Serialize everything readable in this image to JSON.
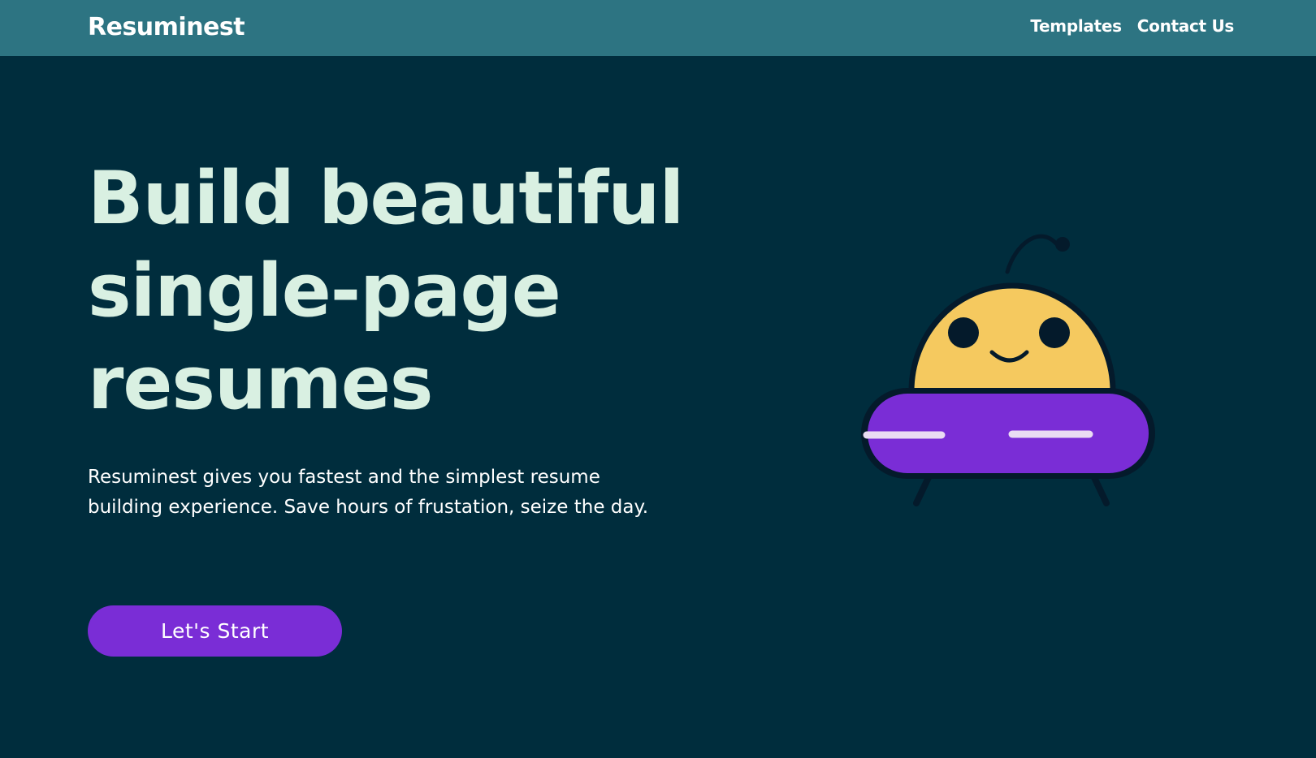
{
  "brand": {
    "name": "Resuminest"
  },
  "nav": {
    "items": [
      {
        "label": "Templates"
      },
      {
        "label": "Contact Us"
      }
    ]
  },
  "hero": {
    "headline": "Build beautiful single-page resumes",
    "description": "Resuminest gives you fastest and the simplest resume building experience. Save hours of frustation, seize the day.",
    "cta_label": "Let's Start"
  },
  "illustration": {
    "icon": "ufo-mascot-icon"
  },
  "colors": {
    "background": "#002d3d",
    "topbar": "#2d7482",
    "headline": "#d9f0e2",
    "accent": "#7a2dd6",
    "mascot_face": "#f5c95f",
    "mascot_outline": "#041a2b"
  }
}
